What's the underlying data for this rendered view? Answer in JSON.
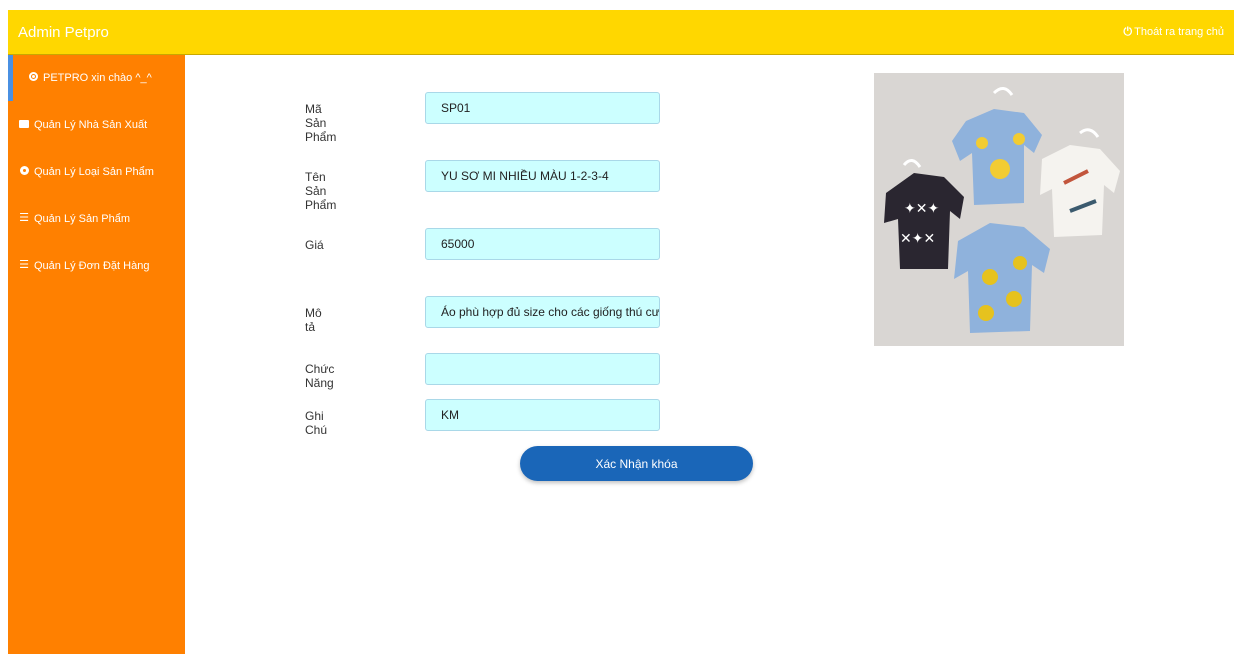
{
  "header": {
    "brand": "Admin Petpro",
    "logout_label": "Thoát ra trang chủ",
    "background": "#ffd700"
  },
  "sidebar": {
    "background": "#ff8000",
    "items": [
      {
        "label": "PETPRO xin chào ^_^",
        "icon": "record-icon",
        "active": true
      },
      {
        "label": "Quản Lý Nhà Sản Xuất",
        "icon": "table-icon"
      },
      {
        "label": "Quản Lý Loại Sản Phẩm",
        "icon": "map-marker-icon"
      },
      {
        "label": "Quản Lý Sản Phẩm",
        "icon": "list-icon"
      },
      {
        "label": "Quản Lý Đơn Đặt Hàng",
        "icon": "list-icon"
      }
    ]
  },
  "form": {
    "fields": [
      {
        "label": "Mã Sản Phẩm",
        "value": "SP01"
      },
      {
        "label": "Tên Sản Phẩm",
        "value": "YU SƠ MI NHIỀU MÀU 1-2-3-4"
      },
      {
        "label": "Giá",
        "value": "65000"
      },
      {
        "label": "Mô tả",
        "value": "Áo phù hợp đủ size cho các giống thú cưng"
      },
      {
        "label": "Chức Năng",
        "value": ""
      },
      {
        "label": "Ghi Chú",
        "value": "KM"
      }
    ],
    "submit_label": "Xác Nhận khóa"
  },
  "product_image": {
    "description_icon": "pet-shirts-photo"
  }
}
